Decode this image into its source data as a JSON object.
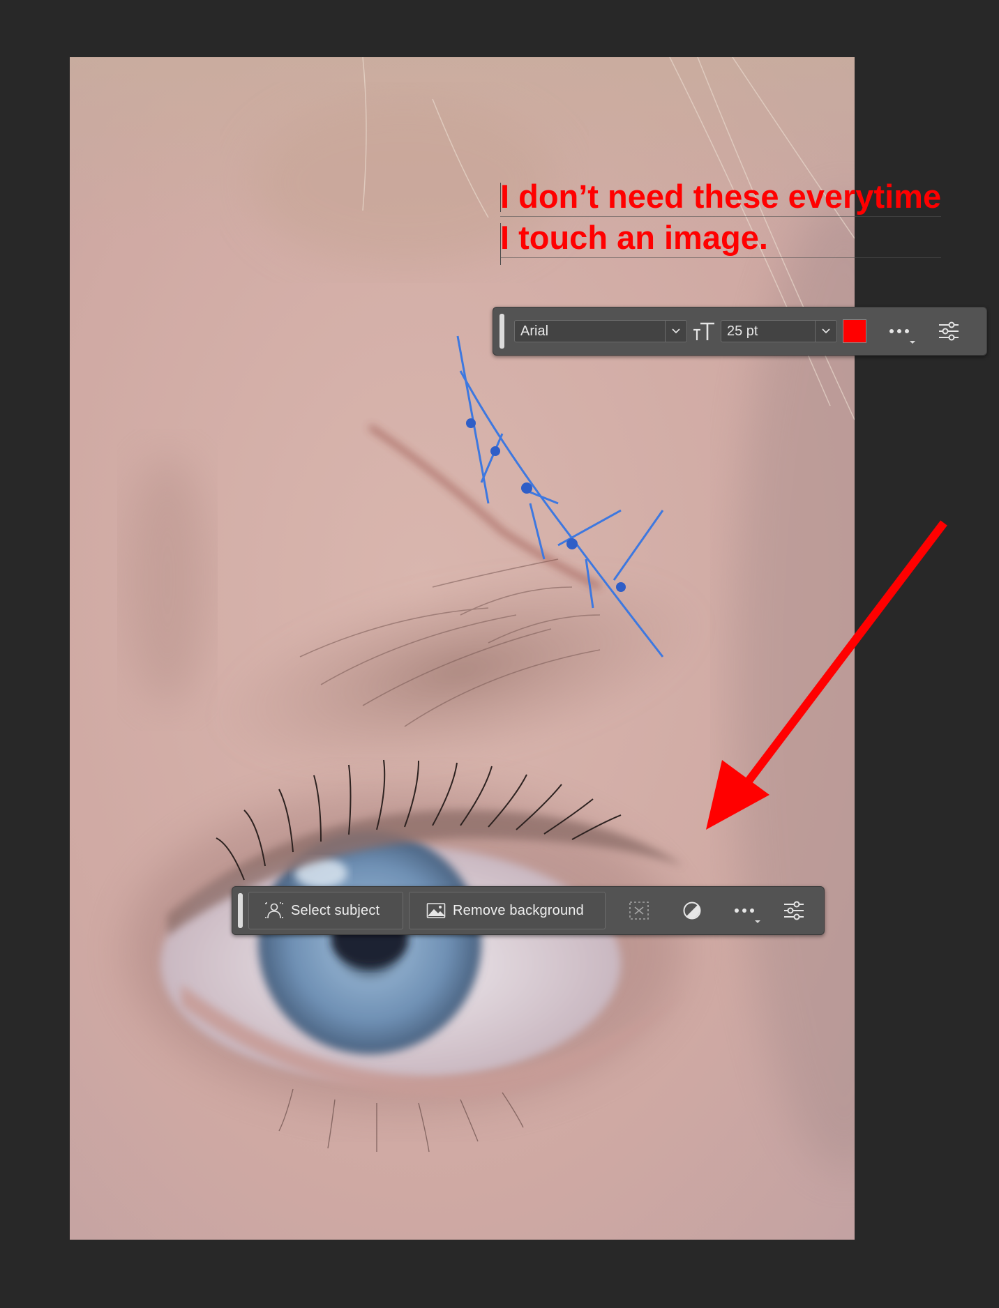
{
  "annotation": {
    "line1": "I don’t need these everytime",
    "line2": "I touch an image.",
    "color": "#ff0000"
  },
  "text_toolbar": {
    "font_family_value": "Arial",
    "font_size_value": "25 pt",
    "text_color": "#ff0000",
    "icons": [
      "grip-handle",
      "chevron-down-icon",
      "text-size-icon",
      "chevron-down-icon",
      "more-icon",
      "sliders-icon"
    ]
  },
  "subject_toolbar": {
    "select_subject_label": "Select subject",
    "remove_background_label": "Remove background",
    "icons": [
      "grip-handle",
      "person-select-icon",
      "image-icon",
      "mask-icon",
      "adjustment-circle-icon",
      "more-icon",
      "sliders-icon"
    ]
  },
  "colors": {
    "workspace_bg": "#282828",
    "toolbar_bg": "#535353",
    "arrow": "#ff0000"
  }
}
